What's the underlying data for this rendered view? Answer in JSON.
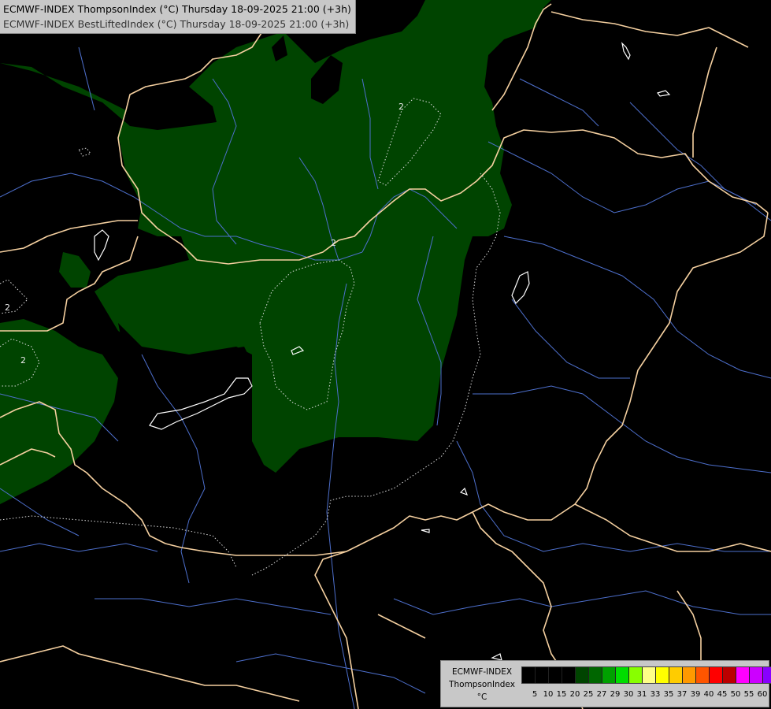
{
  "header": {
    "title_primary": "ECMWF-INDEX ThompsonIndex (°C) Thursday 18-09-2025 21:00 (+3h)",
    "title_secondary": "ECMWF-INDEX BestLiftedIndex (°C) Thursday 18-09-2025 21:00 (+3h)"
  },
  "legend": {
    "model": "ECMWF-INDEX",
    "parameter": "ThompsonIndex",
    "unit": "°C",
    "swatch_colors": [
      "#000000",
      "#000000",
      "#000000",
      "#000000",
      "#004400",
      "#006600",
      "#00a000",
      "#00dd00",
      "#88ff00",
      "#ffff88",
      "#ffff00",
      "#ffcc00",
      "#ff9900",
      "#ff5500",
      "#ff0000",
      "#bb0000",
      "#ff00ff",
      "#cc00ff",
      "#8800ff",
      "#5555ff",
      "#0000ff"
    ],
    "tick_labels": [
      "5",
      "10",
      "15",
      "20",
      "25",
      "27",
      "29",
      "30",
      "31",
      "33",
      "35",
      "37",
      "39",
      "40",
      "45",
      "50",
      "55",
      "60"
    ]
  },
  "map": {
    "contour_labels": [
      "2",
      "2",
      "2",
      "2"
    ],
    "colors": {
      "background": "#000000",
      "fill_green": "#004400",
      "borders": "#f5d0a0",
      "rivers": "#4d6fcc",
      "contour": "#dddddd",
      "lakes": "#ffffff"
    }
  }
}
